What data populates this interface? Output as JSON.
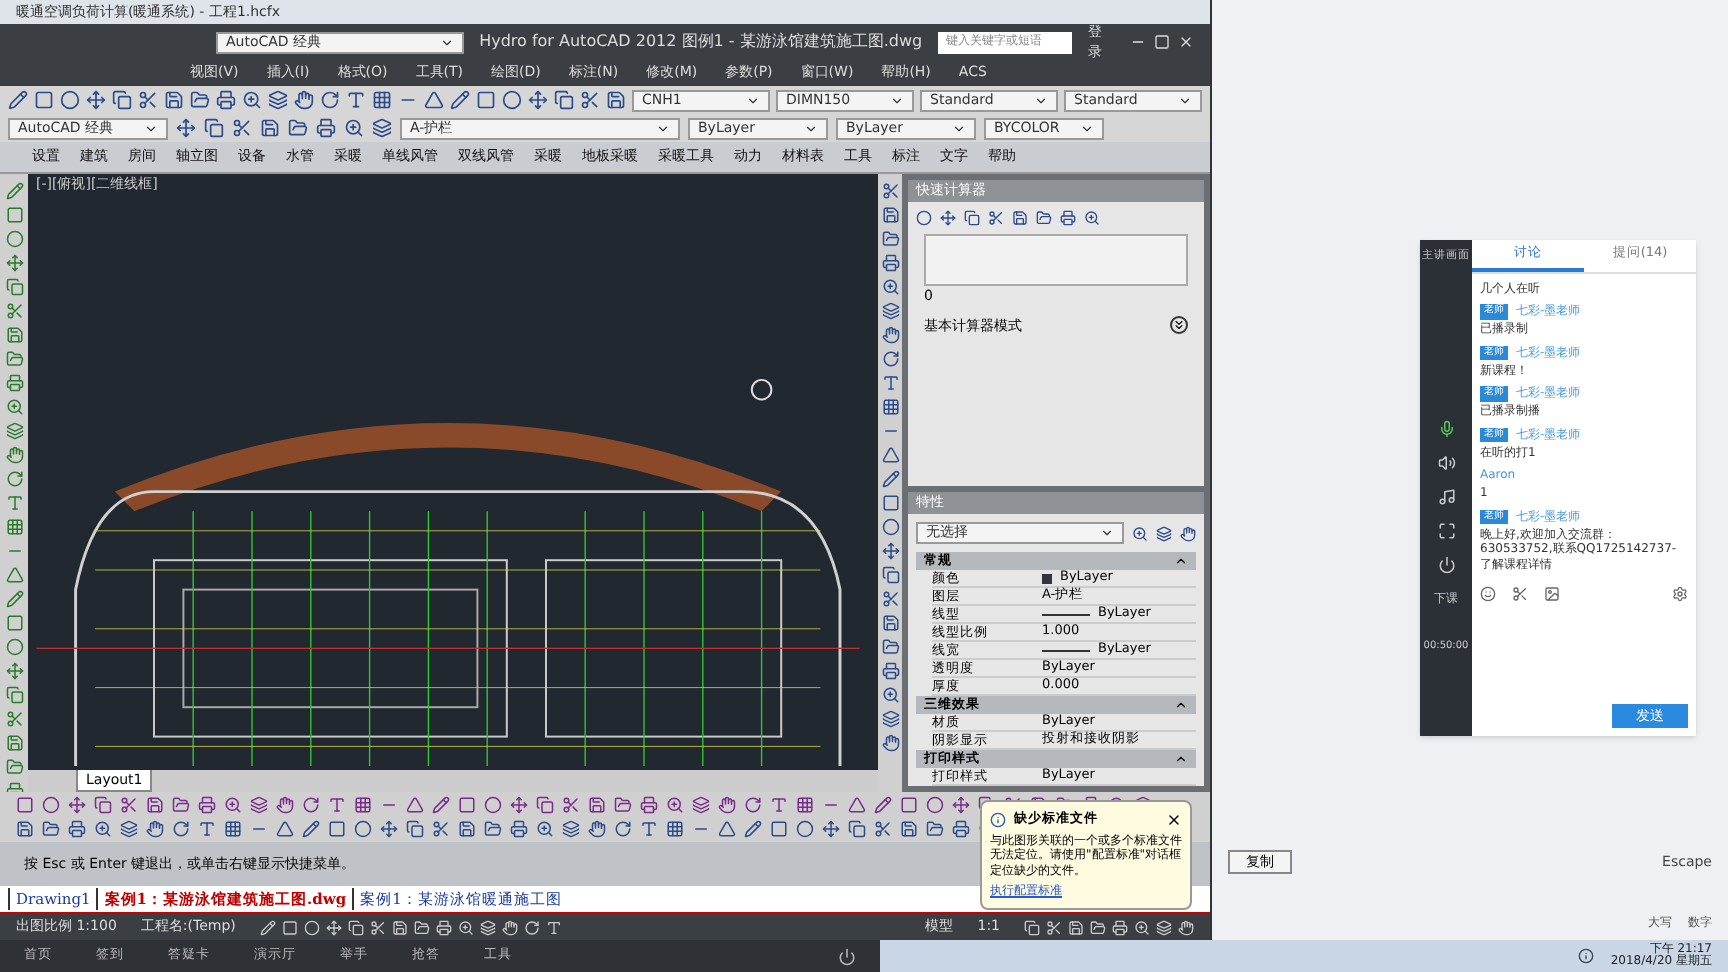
{
  "app_window": {
    "title": "暖通空调负荷计算(暖通系统) - 工程1.hcfx"
  },
  "cad_window": {
    "workspace": "AutoCAD 经典",
    "title": "Hydro for AutoCAD 2012    图例1 - 某游泳馆建筑施工图.dwg",
    "search_placeholder": "键入关键字或短语",
    "user": "登录"
  },
  "menu": [
    "视图(V)",
    "插入(I)",
    "格式(O)",
    "工具(T)",
    "绘图(D)",
    "标注(N)",
    "修改(M)",
    "参数(P)",
    "窗口(W)",
    "帮助(H)",
    "ACS"
  ],
  "toolbar_1": [
    {
      "value": "CNH1"
    },
    {
      "value": "DIMN150"
    },
    {
      "value": "Standard"
    },
    {
      "value": "Standard"
    }
  ],
  "toolbar_2": [
    {
      "value": "AutoCAD 经典"
    },
    {
      "value": "A-护栏"
    },
    {
      "value": "ByLayer"
    },
    {
      "value": "ByLayer"
    },
    {
      "value": "BYCOLOR"
    }
  ],
  "hvac_menu": [
    "设置",
    "建筑",
    "房间",
    "轴立图",
    "设备",
    "水管",
    "采暖",
    "单线风管",
    "双线风管",
    "采暖",
    "地板采暖",
    "采暖工具",
    "动力",
    "材料表",
    "工具",
    "标注",
    "文字",
    "帮助"
  ],
  "viewport_label": "[-][俯视][二维线框]",
  "layout_tab": "Layout1",
  "calculator": {
    "title": "快速计算器",
    "display": "0",
    "mode": "基本计算器模式"
  },
  "properties": {
    "title": "特性",
    "selection": "无选择",
    "sections": [
      {
        "title": "常规",
        "expanded": true,
        "rows": [
          {
            "name": "颜色",
            "value": "ByLayer",
            "kind": "color"
          },
          {
            "name": "图层",
            "value": "A-护栏",
            "kind": "text"
          },
          {
            "name": "线型",
            "value": "ByLayer",
            "kind": "line"
          },
          {
            "name": "线型比例",
            "value": "1.000",
            "kind": "text"
          },
          {
            "name": "线宽",
            "value": "ByLayer",
            "kind": "line"
          },
          {
            "name": "透明度",
            "value": "ByLayer",
            "kind": "text"
          },
          {
            "name": "厚度",
            "value": "0.000",
            "kind": "text"
          }
        ]
      },
      {
        "title": "三维效果",
        "expanded": true,
        "rows": [
          {
            "name": "材质",
            "value": "ByLayer",
            "kind": "text"
          },
          {
            "name": "阴影显示",
            "value": "投射和接收阴影",
            "kind": "text"
          }
        ]
      },
      {
        "title": "打印样式",
        "expanded": true,
        "rows": [
          {
            "name": "打印样式",
            "value": "ByLayer",
            "kind": "text"
          }
        ]
      }
    ]
  },
  "command_line": "按 Esc 或 Enter 键退出，或单击右键显示快捷菜单。",
  "file_tabs": [
    {
      "label": "Drawing1",
      "selected": false
    },
    {
      "label": "案例1：某游泳馆建筑施工图.dwg",
      "selected": true
    },
    {
      "label": "案例1：某游泳馆暖通施工图",
      "selected": false
    }
  ],
  "status_bar": {
    "scale": "出图比例 1:100",
    "project": "工程名:(Temp)",
    "model": "模型",
    "annotation_scale": "1:1"
  },
  "balloon": {
    "title": "缺少标准文件",
    "text": "与此图形关联的一个或多个标准文件无法定位。请使用\"配置标准\"对话框定位缺少的文件。",
    "link": "执行配置标准"
  },
  "right_window": {
    "copy_button": "复制",
    "key_hint": "Escape",
    "indicators": [
      "大写",
      "数字"
    ]
  },
  "live_sidebar": {
    "title": "主讲画面",
    "timer": "00:50:00",
    "end_label": "下课"
  },
  "chat": {
    "tabs": [
      {
        "label": "讨论",
        "selected": true
      },
      {
        "label": "提问(14)",
        "selected": false
      }
    ],
    "messages": [
      {
        "text": "几个人在听"
      },
      {
        "sender": "七彩-墨老师",
        "badge": "老师",
        "text": "已播录制"
      },
      {
        "sender": "七彩-墨老师",
        "badge": "老师",
        "text": "新课程！"
      },
      {
        "sender": "七彩-墨老师",
        "badge": "老师",
        "text": "已播录制播"
      },
      {
        "sender": "七彩-墨老师",
        "badge": "老师",
        "text": "在听的打1"
      },
      {
        "sender": "Aaron",
        "text": "1"
      },
      {
        "sender": "七彩-墨老师",
        "badge": "老师",
        "text": "晚上好,欢迎加入交流群：630533752,联系QQ1725142737-了解课程详情"
      }
    ],
    "send": "发送"
  },
  "class_bar": [
    "首页",
    "签到",
    "答疑卡",
    "演示厅",
    "举手",
    "抢答",
    "工具"
  ],
  "taskbar": {
    "time": "下午 21:17",
    "date": "2018/4/20 星期五"
  }
}
